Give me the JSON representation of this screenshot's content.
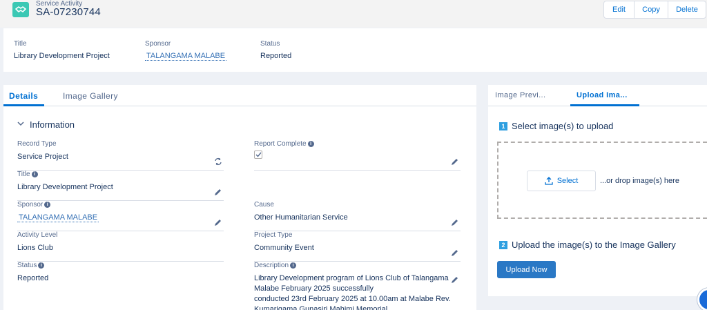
{
  "header": {
    "object_type": "Service Activity",
    "record_name": "SA-07230744",
    "icon": "handshake-icon",
    "actions": [
      "Edit",
      "Copy",
      "Delete"
    ]
  },
  "highlights": {
    "title_label": "Title",
    "title_value": "Library Development Project",
    "sponsor_label": "Sponsor",
    "sponsor_value": "TALANGAMA MALABE",
    "status_label": "Status",
    "status_value": "Reported"
  },
  "left_tabs": [
    "Details",
    "Image Gallery"
  ],
  "section_title": "Information",
  "fields": {
    "record_type": {
      "label": "Record Type",
      "value": "Service Project"
    },
    "title": {
      "label": "Title",
      "value": "Library Development Project"
    },
    "sponsor": {
      "label": "Sponsor",
      "value": "TALANGAMA MALABE"
    },
    "activity_level": {
      "label": "Activity Level",
      "value": "Lions Club"
    },
    "status": {
      "label": "Status",
      "value": "Reported"
    },
    "report_complete": {
      "label": "Report Complete",
      "checked": true
    },
    "cause": {
      "label": "Cause",
      "value": "Other Humanitarian Service"
    },
    "project_type": {
      "label": "Project Type",
      "value": "Community Event"
    },
    "description": {
      "label": "Description",
      "line1": "Library Development program of Lions Club of Talangama",
      "line2": "Malabe February 2025 successfully",
      "line3": "conducted 23rd February 2025 at 10.00am at Malabe Rev.",
      "line4": "Kumarigama Gunasiri Mahimi Memorial"
    }
  },
  "right_tabs": [
    "Image Previ...",
    "Upload Ima..."
  ],
  "upload": {
    "step1_num": "1",
    "step1_label": "Select image(s) to upload",
    "select_label": "Select",
    "drop_text": "...or drop image(s) here",
    "step2_num": "2",
    "step2_label": "Upload the image(s) to the Image Gallery",
    "upload_button": "Upload Now"
  },
  "colors": {
    "accent": "#0070d2",
    "icon_bg": "#3bc8b4",
    "upload_button": "#2a78c5"
  }
}
